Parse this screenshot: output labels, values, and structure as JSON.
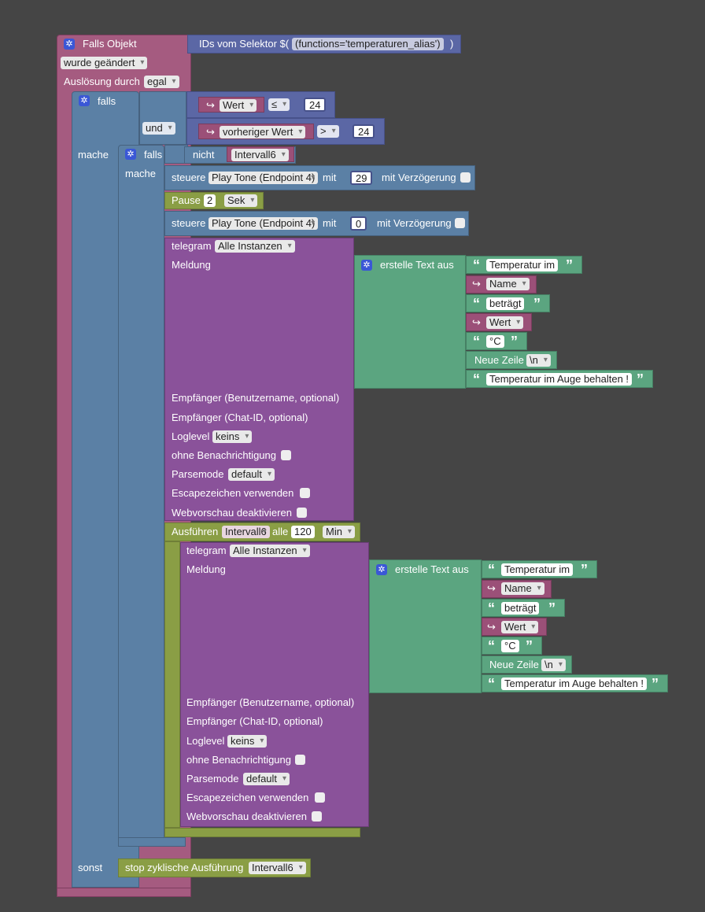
{
  "trigger": {
    "title": "Falls Objekt",
    "selector_prefix": "IDs vom Selektor $(",
    "selector_value": "(functions='temperaturen_alias')",
    "selector_suffix": ")",
    "change_mode": "wurde geändert",
    "ack_label": "Auslösung durch",
    "ack_value": "egal"
  },
  "if_outer": {
    "falls_label": "falls",
    "and_label": "und",
    "cond1": {
      "var": "Wert",
      "op": "≤",
      "value": "24"
    },
    "cond2": {
      "var": "vorheriger Wert",
      "op": ">",
      "value": "24"
    },
    "mache_label": "mache",
    "sonst_label": "sonst"
  },
  "if_inner": {
    "falls_label": "falls",
    "not_label": "nicht",
    "not_var": "Intervall6",
    "mache_label": "mache"
  },
  "control1": {
    "label": "steuere",
    "target": "Play Tone (Endpoint 4)",
    "with_label": "mit",
    "value": "29",
    "delay_label": "mit Verzögerung"
  },
  "pause": {
    "label": "Pause",
    "value": "2",
    "unit": "Sek"
  },
  "control2": {
    "label": "steuere",
    "target": "Play Tone (Endpoint 4)",
    "with_label": "mit",
    "value": "0",
    "delay_label": "mit Verzögerung"
  },
  "telegram1": {
    "label": "telegram",
    "instance": "Alle Instanzen",
    "message_label": "Meldung",
    "text_block": {
      "label": "erstelle Text aus",
      "items": [
        {
          "type": "text",
          "value": "Temperatur im"
        },
        {
          "type": "var",
          "value": "Name"
        },
        {
          "type": "text",
          "value": "beträgt"
        },
        {
          "type": "var",
          "value": "Wert"
        },
        {
          "type": "text",
          "value": "°C"
        },
        {
          "type": "newline",
          "label": "Neue Zeile",
          "value": "\\n"
        },
        {
          "type": "text",
          "value": "Temperatur im Auge behalten !"
        }
      ]
    },
    "recipient_user": "Empfänger (Benutzername, optional)",
    "recipient_chat": "Empfänger (Chat-ID, optional)",
    "loglevel_label": "Loglevel",
    "loglevel_value": "keins",
    "silent_label": "ohne Benachrichtigung",
    "parsemode_label": "Parsemode",
    "parsemode_value": "default",
    "escape_label": "Escapezeichen verwenden",
    "preview_label": "Webvorschau deaktivieren"
  },
  "interval": {
    "label": "Ausführen",
    "var": "Intervall6",
    "every_label": "alle",
    "value": "120",
    "unit": "Min"
  },
  "telegram2": {
    "label": "telegram",
    "instance": "Alle Instanzen",
    "message_label": "Meldung",
    "text_block": {
      "label": "erstelle Text aus",
      "items": [
        {
          "type": "text",
          "value": "Temperatur im"
        },
        {
          "type": "var",
          "value": "Name"
        },
        {
          "type": "text",
          "value": "beträgt"
        },
        {
          "type": "var",
          "value": "Wert"
        },
        {
          "type": "text",
          "value": "°C"
        },
        {
          "type": "newline",
          "label": "Neue Zeile",
          "value": "\\n"
        },
        {
          "type": "text",
          "value": "Temperatur im Auge behalten !"
        }
      ]
    },
    "recipient_user": "Empfänger (Benutzername, optional)",
    "recipient_chat": "Empfänger (Chat-ID, optional)",
    "loglevel_label": "Loglevel",
    "loglevel_value": "keins",
    "silent_label": "ohne Benachrichtigung",
    "parsemode_label": "Parsemode",
    "parsemode_value": "default",
    "escape_label": "Escapezeichen verwenden",
    "preview_label": "Webvorschau deaktivieren"
  },
  "stop": {
    "label": "stop zyklische Ausführung",
    "var": "Intervall6"
  },
  "colors": {
    "background": "#454545",
    "trigger": "#a55b80",
    "control": "#5b80a5",
    "compare": "#5b67a5",
    "timer": "#8a9e45",
    "telegram": "#8a529a",
    "text": "#5ba580",
    "variable": "#9b5078"
  }
}
